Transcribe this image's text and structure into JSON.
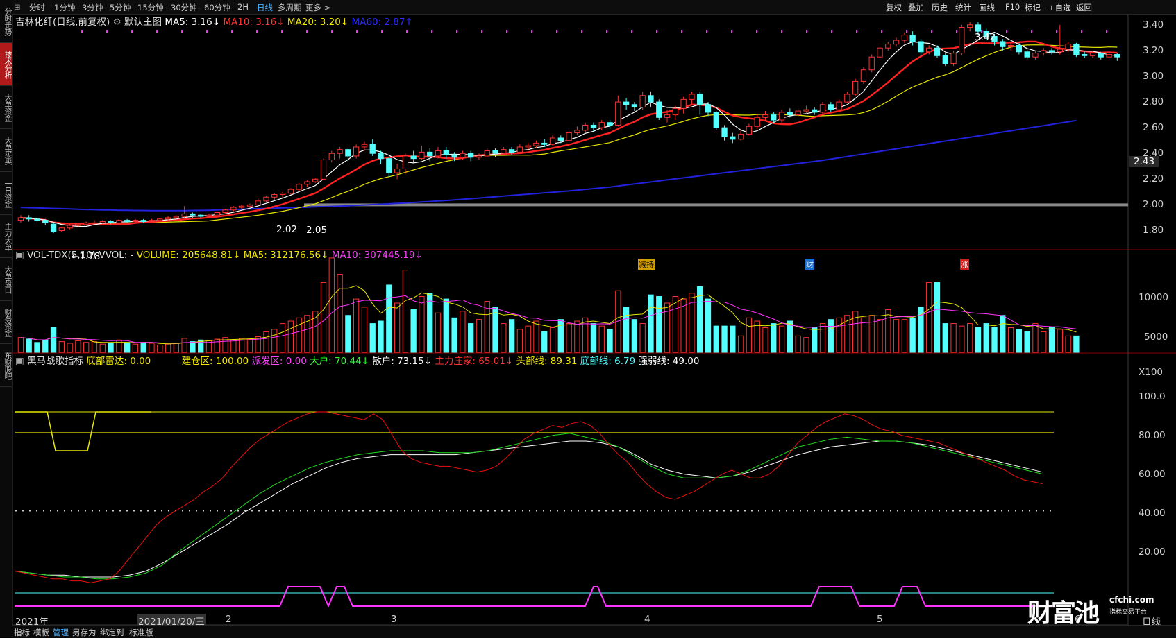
{
  "sidebar": {
    "tabs": [
      {
        "label": "分时走势",
        "active": false
      },
      {
        "label": "技术分析",
        "active": true
      },
      {
        "label": "大单资金",
        "active": false
      },
      {
        "label": "大单买卖",
        "active": false
      },
      {
        "label": "一日资金",
        "active": false
      },
      {
        "label": "主力大单",
        "active": false
      },
      {
        "label": "大单盘口",
        "active": false
      },
      {
        "label": "财务资金",
        "active": false
      },
      {
        "label": "东财股吧",
        "active": false
      }
    ]
  },
  "topbar": {
    "periods": [
      "分时",
      "1分钟",
      "3分钟",
      "5分钟",
      "15分钟",
      "30分钟",
      "60分钟",
      "2H",
      "日线",
      "多周期",
      "更多 >"
    ],
    "active_period": "日线",
    "tools": [
      "复权",
      "叠加",
      "历史",
      "统计",
      "画线",
      "F10",
      "标记",
      "+自选",
      "返回"
    ]
  },
  "main_legend": {
    "title": "吉林化纤(日线,前复权)",
    "template": "默认主图",
    "ma5": "MA5: 3.16↓",
    "ma10": "MA10: 3.16↓",
    "ma20": "MA20: 3.20↓",
    "ma60": "MA60: 2.87↑"
  },
  "colors": {
    "up": "#ff3333",
    "down": "#54ffff",
    "ma5": "#ffffff",
    "ma10": "#ff2222",
    "ma20": "#e8e800",
    "ma60": "#2222dd",
    "magenta": "#ff33ff"
  },
  "price_axis": {
    "labels": [
      "3.40",
      "3.20",
      "3.00",
      "2.80",
      "2.60",
      "2.40",
      "2.20",
      "2.00",
      "1.80"
    ],
    "current": "2.43"
  },
  "price_annotations": {
    "high": "3.42",
    "low": "←1.78",
    "p1": "2.02",
    "p2": "2.05"
  },
  "markers": [
    "减持",
    "财",
    "涨"
  ],
  "vol_legend": {
    "name": "VOL-TDX(5,10) VVOL: -",
    "volume": "VOLUME: 205648.81↓",
    "ma5": "MA5: 312176.56↓",
    "ma10": "MA10: 307445.19↓"
  },
  "vol_axis": {
    "labels": [
      "10000",
      "5000",
      "X100"
    ]
  },
  "ind_legend": {
    "name": "黑马战歌指标",
    "d1": "底部雷达: 0.00",
    "d2": "建仓区: 100.00",
    "d3": "派发区: 0.00",
    "d4": "大户: 70.44↓",
    "d5": "散户: 73.15↓",
    "d6": "主力庄家: 65.01↓",
    "d7": "头部线: 89.31",
    "d8": "底部线: 6.79",
    "d9": "强弱线: 49.00"
  },
  "ind_axis": {
    "labels": [
      "100.0",
      "80.00",
      "60.00",
      "40.00",
      "20.00"
    ]
  },
  "dates": {
    "year": "2021年",
    "cursor": "2021/01/20/三",
    "months": [
      "2",
      "3",
      "4",
      "5",
      "6"
    ],
    "period": "日线"
  },
  "bottombar": {
    "tabs": [
      "指标",
      "模板",
      "管理",
      "另存为",
      "绑定到",
      "标准版"
    ],
    "active": "管理"
  },
  "watermark": {
    "brand": "财富池",
    "url": "cfchi.com",
    "sub": "指标交易平台"
  },
  "chart_data": {
    "type": "candlestick",
    "candles": [
      [
        1.88,
        1.9,
        1.92,
        1.86
      ],
      [
        1.9,
        1.89,
        1.92,
        1.87
      ],
      [
        1.89,
        1.88,
        1.9,
        1.86
      ],
      [
        1.88,
        1.86,
        1.89,
        1.84
      ],
      [
        1.85,
        1.79,
        1.86,
        1.78
      ],
      [
        1.8,
        1.82,
        1.83,
        1.79
      ],
      [
        1.82,
        1.84,
        1.85,
        1.81
      ],
      [
        1.84,
        1.85,
        1.86,
        1.83
      ],
      [
        1.85,
        1.86,
        1.87,
        1.84
      ],
      [
        1.86,
        1.86,
        1.88,
        1.85
      ],
      [
        1.86,
        1.87,
        1.88,
        1.85
      ],
      [
        1.87,
        1.86,
        1.88,
        1.85
      ],
      [
        1.86,
        1.88,
        1.89,
        1.85
      ],
      [
        1.88,
        1.87,
        1.89,
        1.86
      ],
      [
        1.87,
        1.88,
        1.89,
        1.86
      ],
      [
        1.88,
        1.87,
        1.89,
        1.86
      ],
      [
        1.87,
        1.88,
        1.89,
        1.86
      ],
      [
        1.88,
        1.89,
        1.9,
        1.87
      ],
      [
        1.89,
        1.9,
        1.91,
        1.88
      ],
      [
        1.9,
        1.91,
        1.92,
        1.89
      ],
      [
        1.91,
        1.93,
        1.99,
        1.9
      ],
      [
        1.93,
        1.92,
        1.94,
        1.9
      ],
      [
        1.92,
        1.91,
        1.93,
        1.9
      ],
      [
        1.91,
        1.92,
        1.93,
        1.9
      ],
      [
        1.92,
        1.94,
        1.95,
        1.91
      ],
      [
        1.94,
        1.96,
        1.97,
        1.93
      ],
      [
        1.96,
        1.98,
        1.99,
        1.95
      ],
      [
        1.98,
        1.99,
        2.0,
        1.97
      ],
      [
        1.99,
        2.0,
        2.01,
        1.98
      ],
      [
        2.0,
        2.03,
        2.05,
        1.99
      ],
      [
        2.03,
        2.06,
        2.07,
        2.02
      ],
      [
        2.06,
        2.08,
        2.09,
        2.04
      ],
      [
        2.08,
        2.09,
        2.1,
        2.05
      ],
      [
        2.09,
        2.12,
        2.13,
        2.08
      ],
      [
        2.12,
        2.16,
        2.17,
        2.11
      ],
      [
        2.16,
        2.18,
        2.19,
        2.14
      ],
      [
        2.18,
        2.2,
        2.21,
        2.17
      ],
      [
        2.2,
        2.35,
        2.36,
        2.19
      ],
      [
        2.35,
        2.4,
        2.42,
        2.33
      ],
      [
        2.4,
        2.43,
        2.45,
        2.36
      ],
      [
        2.43,
        2.38,
        2.44,
        2.34
      ],
      [
        2.38,
        2.45,
        2.47,
        2.36
      ],
      [
        2.45,
        2.47,
        2.49,
        2.42
      ],
      [
        2.47,
        2.4,
        2.51,
        2.38
      ],
      [
        2.4,
        2.36,
        2.42,
        2.32
      ],
      [
        2.36,
        2.25,
        2.37,
        2.22
      ],
      [
        2.25,
        2.28,
        2.32,
        2.2
      ],
      [
        2.28,
        2.38,
        2.4,
        2.24
      ],
      [
        2.38,
        2.36,
        2.42,
        2.33
      ],
      [
        2.36,
        2.41,
        2.46,
        2.35
      ],
      [
        2.41,
        2.38,
        2.44,
        2.34
      ],
      [
        2.38,
        2.42,
        2.45,
        2.36
      ],
      [
        2.42,
        2.39,
        2.45,
        2.36
      ],
      [
        2.39,
        2.37,
        2.41,
        2.34
      ],
      [
        2.37,
        2.4,
        2.42,
        2.35
      ],
      [
        2.4,
        2.37,
        2.42,
        2.34
      ],
      [
        2.37,
        2.38,
        2.4,
        2.35
      ],
      [
        2.38,
        2.42,
        2.44,
        2.37
      ],
      [
        2.42,
        2.4,
        2.44,
        2.37
      ],
      [
        2.4,
        2.43,
        2.45,
        2.38
      ],
      [
        2.43,
        2.41,
        2.45,
        2.39
      ],
      [
        2.41,
        2.45,
        2.47,
        2.4
      ],
      [
        2.45,
        2.46,
        2.48,
        2.43
      ],
      [
        2.46,
        2.48,
        2.5,
        2.44
      ],
      [
        2.48,
        2.47,
        2.51,
        2.45
      ],
      [
        2.47,
        2.52,
        2.54,
        2.46
      ],
      [
        2.52,
        2.5,
        2.54,
        2.48
      ],
      [
        2.5,
        2.56,
        2.58,
        2.49
      ],
      [
        2.56,
        2.58,
        2.61,
        2.54
      ],
      [
        2.58,
        2.62,
        2.64,
        2.56
      ],
      [
        2.62,
        2.6,
        2.64,
        2.57
      ],
      [
        2.6,
        2.64,
        2.66,
        2.58
      ],
      [
        2.64,
        2.62,
        2.66,
        2.59
      ],
      [
        2.62,
        2.8,
        2.85,
        2.61
      ],
      [
        2.8,
        2.78,
        2.83,
        2.74
      ],
      [
        2.78,
        2.76,
        2.8,
        2.73
      ],
      [
        2.76,
        2.85,
        2.88,
        2.74
      ],
      [
        2.85,
        2.8,
        2.88,
        2.76
      ],
      [
        2.8,
        2.68,
        2.82,
        2.66
      ],
      [
        2.68,
        2.7,
        2.74,
        2.64
      ],
      [
        2.7,
        2.75,
        2.77,
        2.66
      ],
      [
        2.75,
        2.82,
        2.84,
        2.71
      ],
      [
        2.82,
        2.86,
        2.88,
        2.78
      ],
      [
        2.86,
        2.78,
        2.88,
        2.7
      ],
      [
        2.78,
        2.72,
        2.8,
        2.69
      ],
      [
        2.72,
        2.6,
        2.73,
        2.58
      ],
      [
        2.6,
        2.53,
        2.62,
        2.5
      ],
      [
        2.53,
        2.51,
        2.56,
        2.48
      ],
      [
        2.51,
        2.55,
        2.58,
        2.5
      ],
      [
        2.55,
        2.61,
        2.63,
        2.54
      ],
      [
        2.61,
        2.68,
        2.71,
        2.59
      ],
      [
        2.68,
        2.7,
        2.73,
        2.66
      ],
      [
        2.7,
        2.66,
        2.72,
        2.64
      ],
      [
        2.66,
        2.72,
        2.74,
        2.64
      ],
      [
        2.72,
        2.7,
        2.75,
        2.68
      ],
      [
        2.7,
        2.73,
        2.75,
        2.68
      ],
      [
        2.73,
        2.74,
        2.77,
        2.71
      ],
      [
        2.74,
        2.72,
        2.76,
        2.7
      ],
      [
        2.72,
        2.78,
        2.8,
        2.7
      ],
      [
        2.78,
        2.74,
        2.8,
        2.72
      ],
      [
        2.74,
        2.8,
        2.82,
        2.73
      ],
      [
        2.8,
        2.86,
        2.88,
        2.79
      ],
      [
        2.86,
        2.96,
        2.98,
        2.85
      ],
      [
        2.96,
        3.05,
        3.07,
        2.94
      ],
      [
        3.05,
        3.15,
        3.17,
        3.03
      ],
      [
        3.15,
        3.22,
        3.24,
        3.13
      ],
      [
        3.22,
        3.25,
        3.27,
        3.2
      ],
      [
        3.25,
        3.28,
        3.3,
        3.23
      ],
      [
        3.28,
        3.32,
        3.34,
        3.26
      ],
      [
        3.32,
        3.27,
        3.35,
        3.24
      ],
      [
        3.27,
        3.19,
        3.29,
        3.16
      ],
      [
        3.19,
        3.22,
        3.24,
        3.17
      ],
      [
        3.22,
        3.16,
        3.24,
        3.14
      ],
      [
        3.16,
        3.1,
        3.18,
        3.08
      ],
      [
        3.1,
        3.18,
        3.2,
        3.08
      ],
      [
        3.18,
        3.38,
        3.4,
        3.16
      ],
      [
        3.38,
        3.4,
        3.42,
        3.35
      ],
      [
        3.4,
        3.35,
        3.42,
        3.32
      ],
      [
        3.35,
        3.31,
        3.37,
        3.28
      ],
      [
        3.31,
        3.27,
        3.33,
        3.24
      ],
      [
        3.27,
        3.23,
        3.29,
        3.2
      ],
      [
        3.23,
        3.24,
        3.26,
        3.2
      ],
      [
        3.24,
        3.19,
        3.26,
        3.17
      ],
      [
        3.19,
        3.15,
        3.21,
        3.13
      ],
      [
        3.15,
        3.18,
        3.2,
        3.13
      ],
      [
        3.18,
        3.2,
        3.22,
        3.16
      ],
      [
        3.2,
        3.19,
        3.22,
        3.17
      ],
      [
        3.19,
        3.21,
        3.4,
        3.17
      ],
      [
        3.21,
        3.25,
        3.27,
        3.19
      ],
      [
        3.25,
        3.17,
        3.26,
        3.15
      ],
      [
        3.17,
        3.16,
        3.19,
        3.14
      ],
      [
        3.16,
        3.18,
        3.2,
        3.14
      ],
      [
        3.18,
        3.15,
        3.19,
        3.13
      ],
      [
        3.15,
        3.17,
        3.19,
        3.13
      ],
      [
        3.17,
        3.15,
        3.18,
        3.12
      ]
    ],
    "volume": [
      1.8,
      1.6,
      1.2,
      1.5,
      3.0,
      1.3,
      1.1,
      1.4,
      1.2,
      1.3,
      1.0,
      1.1,
      1.5,
      1.2,
      1.0,
      1.2,
      1.1,
      0.9,
      1.0,
      1.1,
      1.7,
      1.3,
      1.5,
      1.4,
      1.6,
      1.8,
      1.5,
      1.7,
      1.6,
      1.9,
      2.5,
      2.8,
      3.5,
      3.8,
      4.2,
      4.5,
      5.0,
      8.5,
      11.5,
      9.5,
      4.5,
      6.5,
      5.5,
      3.5,
      3.8,
      8.2,
      6.0,
      10.0,
      5.2,
      6.8,
      7.2,
      4.8,
      6.5,
      4.2,
      5.0,
      3.5,
      4.0,
      6.2,
      5.5,
      3.5,
      4.0,
      2.8,
      3.2,
      3.8,
      2.5,
      3.0,
      4.0,
      3.5,
      3.8,
      4.2,
      3.5,
      3.2,
      2.8,
      7.5,
      5.5,
      4.0,
      3.5,
      7.0,
      6.8,
      6.0,
      6.8,
      6.5,
      7.2,
      8.0,
      6.5,
      3.2,
      3.2,
      3.2,
      2.0,
      4.2,
      3.8,
      3.0,
      3.5,
      3.2,
      3.8,
      2.0,
      1.8,
      3.0,
      3.5,
      4.0,
      4.2,
      4.5,
      5.0,
      4.2,
      4.5,
      4.0,
      5.2,
      4.0,
      4.0,
      4.2,
      5.5,
      8.5,
      8.5,
      3.5,
      3.5,
      3.2,
      3.5,
      3.0,
      3.5,
      3.0,
      4.5,
      3.0,
      2.8,
      2.5,
      3.5,
      2.5,
      3.0,
      2.8,
      2.0,
      2.0
    ],
    "ma60": [
      1.98,
      1.978,
      1.976,
      1.974,
      1.972,
      1.97,
      1.968,
      1.966,
      1.964,
      1.962,
      1.96,
      1.96,
      1.958,
      1.958,
      1.956,
      1.956,
      1.955,
      1.955,
      1.955,
      1.955,
      1.955,
      1.956,
      1.957,
      1.958,
      1.96,
      1.962,
      1.964,
      1.966,
      1.968,
      1.97,
      1.972,
      1.974,
      1.976,
      1.978,
      1.98,
      1.982,
      1.984,
      1.986,
      1.988,
      1.99,
      1.993,
      1.996,
      1.999,
      2.002,
      2.005,
      2.008,
      2.011,
      2.014,
      2.018,
      2.022,
      2.026,
      2.03,
      2.034,
      2.038,
      2.043,
      2.048,
      2.053,
      2.058,
      2.063,
      2.068,
      2.073,
      2.078,
      2.083,
      2.088,
      2.093,
      2.098,
      2.103,
      2.108,
      2.114,
      2.12,
      2.126,
      2.132,
      2.138,
      2.146,
      2.154,
      2.162,
      2.17,
      2.178,
      2.186,
      2.194,
      2.202,
      2.21,
      2.218,
      2.226,
      2.234,
      2.242,
      2.25,
      2.258,
      2.266,
      2.274,
      2.282,
      2.29,
      2.298,
      2.306,
      2.314,
      2.322,
      2.33,
      2.338,
      2.346,
      2.356,
      2.366,
      2.376,
      2.386,
      2.396,
      2.406,
      2.416,
      2.426,
      2.436,
      2.446,
      2.456,
      2.466,
      2.476,
      2.486,
      2.496,
      2.506,
      2.516,
      2.526,
      2.536,
      2.546,
      2.556,
      2.566,
      2.576,
      2.586,
      2.596,
      2.606,
      2.616,
      2.626,
      2.636,
      2.646,
      2.656
    ],
    "ind_main_red": [
      18,
      17,
      16,
      15,
      14,
      14,
      13,
      13,
      12,
      13,
      14,
      18,
      24,
      30,
      36,
      42,
      46,
      49,
      52,
      55,
      59,
      62,
      66,
      72,
      77,
      82,
      86,
      89,
      92,
      95,
      97,
      99,
      100,
      100,
      99,
      98,
      97,
      96,
      99,
      96,
      88,
      80,
      76,
      74,
      73,
      72,
      72,
      71,
      70,
      69,
      70,
      72,
      76,
      81,
      86,
      89,
      91,
      93,
      92,
      94,
      95,
      93,
      89,
      83,
      78,
      74,
      68,
      63,
      59,
      56,
      55,
      57,
      59,
      62,
      65,
      68,
      70,
      68,
      66,
      66,
      68,
      72,
      78,
      84,
      88,
      92,
      95,
      97,
      99,
      98,
      96,
      93,
      91,
      90,
      88,
      87,
      86,
      85,
      84,
      82,
      80,
      78,
      76,
      74,
      72,
      70,
      67,
      65,
      64,
      63
    ],
    "ind_green": [
      18,
      17,
      16,
      15,
      15,
      14,
      14,
      15,
      17,
      21,
      28,
      34,
      40,
      46,
      52,
      58,
      63,
      67,
      71,
      74,
      76,
      78,
      79,
      80,
      80,
      80,
      79,
      79,
      79,
      80,
      82,
      84,
      86,
      88,
      89,
      87,
      85,
      82,
      77,
      72,
      68,
      66,
      66,
      66,
      67,
      70,
      74,
      78,
      82,
      84,
      86,
      87,
      86,
      85,
      85,
      84,
      82,
      80,
      78,
      76,
      74,
      72,
      70,
      68
    ],
    "ind_white": [
      18,
      17,
      16,
      16,
      15,
      15,
      15,
      16,
      18,
      22,
      27,
      32,
      37,
      42,
      48,
      53,
      58,
      63,
      67,
      71,
      74,
      76,
      77,
      78,
      78,
      78,
      78,
      78,
      79,
      80,
      81,
      82,
      83,
      84,
      85,
      85,
      84,
      82,
      78,
      73,
      70,
      68,
      67,
      66,
      67,
      69,
      72,
      75,
      78,
      80,
      82,
      83,
      84,
      85,
      85,
      84,
      83,
      81,
      79,
      77,
      75,
      73,
      71,
      69
    ]
  }
}
